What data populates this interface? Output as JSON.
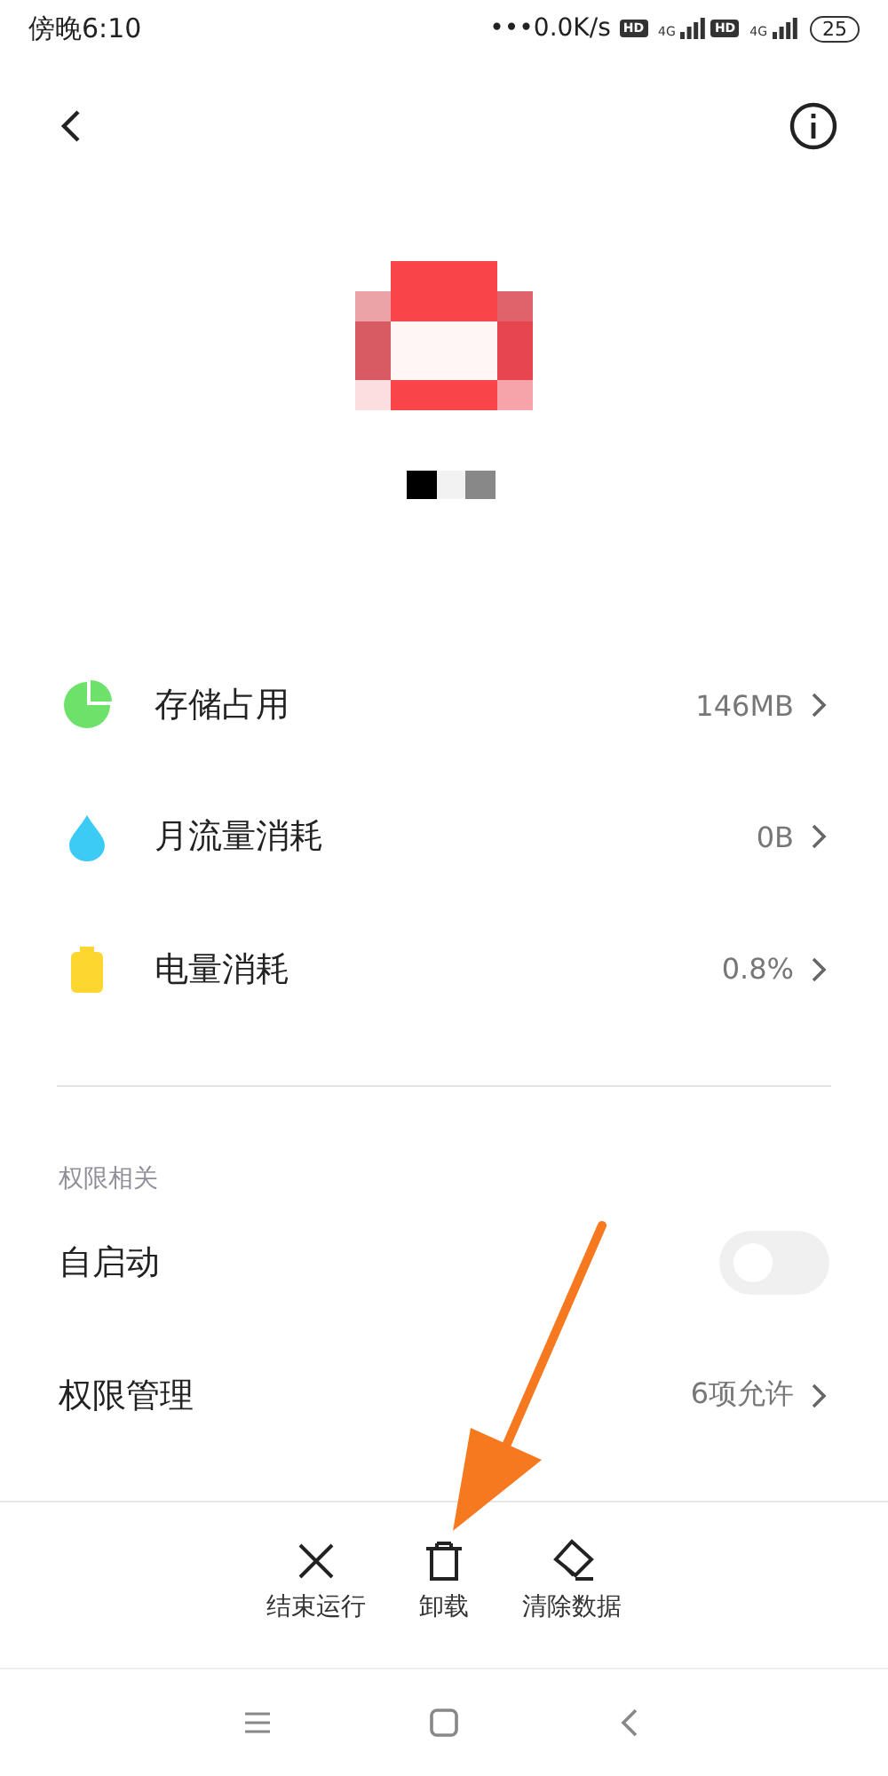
{
  "status_bar": {
    "time": "傍晚6:10",
    "network_speed": "•••0.0K/s",
    "sim_1": {
      "hd": "HD",
      "network_type": "4G"
    },
    "sim_2": {
      "hd": "HD",
      "network_type": "4G"
    },
    "battery": "25"
  },
  "usage_items": [
    {
      "kind": "storage",
      "label": "存储占用",
      "value": "146MB",
      "color": "#6ee16a"
    },
    {
      "kind": "data",
      "label": "月流量消耗",
      "value": "0B",
      "color": "#3ccbf5"
    },
    {
      "kind": "battery",
      "label": "电量消耗",
      "value": "0.8%",
      "color": "#fdd630"
    }
  ],
  "permissions": {
    "title": "权限相关",
    "items": [
      {
        "kind": "toggle",
        "label": "自启动",
        "on": false
      },
      {
        "kind": "link",
        "label": "权限管理",
        "value": "6项允许"
      }
    ]
  },
  "actions": [
    {
      "kind": "stop",
      "label": "结束运行"
    },
    {
      "kind": "uninstall",
      "label": "卸载"
    },
    {
      "kind": "clear",
      "label": "清除数据"
    }
  ],
  "nav_bar": [
    {
      "kind": "menu"
    },
    {
      "kind": "home"
    },
    {
      "kind": "back"
    }
  ]
}
